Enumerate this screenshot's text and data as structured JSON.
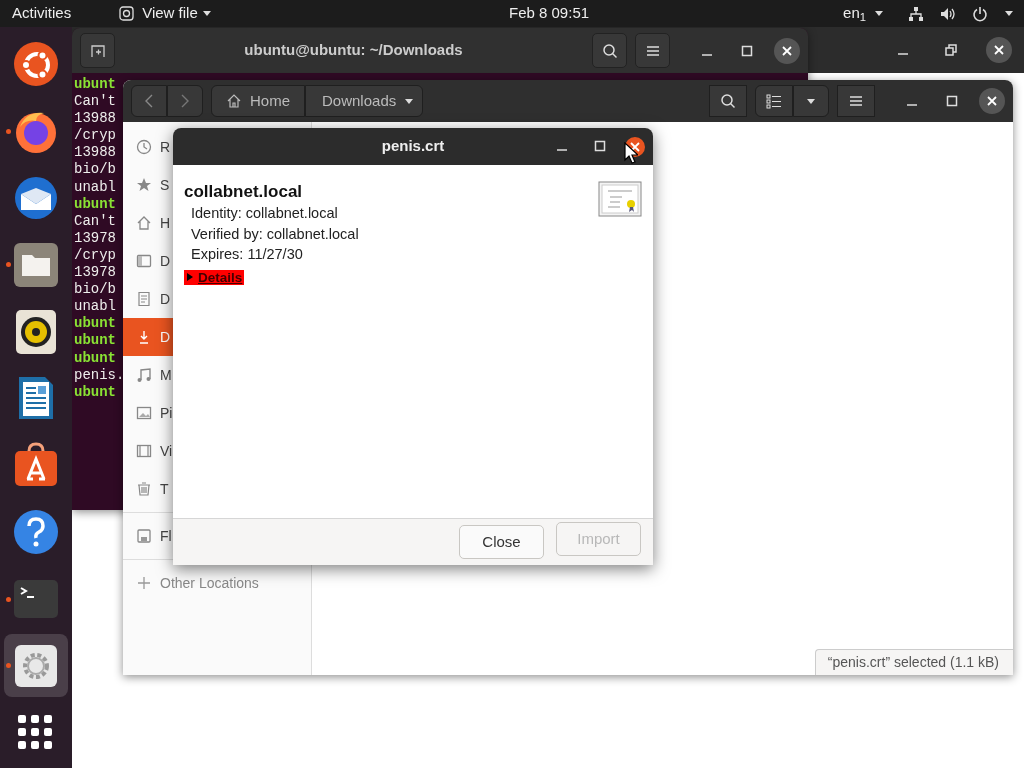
{
  "top_bar": {
    "activities": "Activities",
    "app_menu": "View file",
    "clock": "Feb 8  09:51",
    "input_source": "en$_{1}$"
  },
  "dock": [
    {
      "kind": "ubuntu",
      "running": false,
      "active": false
    },
    {
      "kind": "firefox",
      "running": true,
      "active": false
    },
    {
      "kind": "thunderbird",
      "running": false,
      "active": false
    },
    {
      "kind": "files",
      "running": true,
      "active": false
    },
    {
      "kind": "rhythmbox",
      "running": false,
      "active": false
    },
    {
      "kind": "writer",
      "running": false,
      "active": false
    },
    {
      "kind": "software",
      "running": false,
      "active": false
    },
    {
      "kind": "help",
      "running": false,
      "active": false
    },
    {
      "kind": "terminal",
      "running": true,
      "active": false
    },
    {
      "kind": "settings",
      "running": true,
      "active": true
    },
    {
      "kind": "apps",
      "running": false,
      "active": false
    }
  ],
  "terminal": {
    "title": "ubuntu@ubuntu: ~/Downloads",
    "lines": [
      {
        "text": "ubunt",
        "kind": "prompt"
      },
      {
        "text": "Can't",
        "kind": "output"
      },
      {
        "text": "13988",
        "kind": "output"
      },
      {
        "text": "/cryp",
        "kind": "output"
      },
      {
        "text": "13988",
        "kind": "output"
      },
      {
        "text": "bio/b",
        "kind": "output"
      },
      {
        "text": "unabl",
        "kind": "output"
      },
      {
        "text": "ubunt",
        "kind": "prompt"
      },
      {
        "text": "Can't",
        "kind": "output"
      },
      {
        "text": "13978",
        "kind": "output"
      },
      {
        "text": "/cryp",
        "kind": "output"
      },
      {
        "text": "13978",
        "kind": "output"
      },
      {
        "text": "bio/b",
        "kind": "output"
      },
      {
        "text": "unabl",
        "kind": "output"
      },
      {
        "text": "ubunt",
        "kind": "prompt"
      },
      {
        "text": "ubunt",
        "kind": "prompt"
      },
      {
        "text": "ubunt",
        "kind": "prompt"
      },
      {
        "text": "penis.",
        "kind": "output"
      },
      {
        "text": "ubunt",
        "kind": "prompt"
      }
    ]
  },
  "files": {
    "path": [
      {
        "label": "Home",
        "kind": "home"
      },
      {
        "label": "Downloads",
        "kind": "current"
      }
    ],
    "sidebar": [
      [
        {
          "label": "R",
          "selected": false
        },
        {
          "label": "S",
          "selected": false
        },
        {
          "label": "H",
          "selected": false
        },
        {
          "label": "D",
          "selected": false
        },
        {
          "label": "D",
          "selected": false
        },
        {
          "label": "D",
          "selected": true
        },
        {
          "label": "M",
          "selected": false
        },
        {
          "label": "Pi",
          "selected": false
        },
        {
          "label": "Vi",
          "selected": false
        },
        {
          "label": "T",
          "selected": false
        }
      ],
      [
        {
          "label": "Fl",
          "selected": false
        }
      ],
      [
        {
          "label": "Other Locations",
          "selected": false
        }
      ]
    ],
    "status": "“penis.crt” selected  (1.1 kB)"
  },
  "dialog": {
    "title": "penis.crt",
    "name": "collabnet.local",
    "fields": [
      "Identity: collabnet.local",
      "Verified by: collabnet.local",
      "Expires: 11/27/30"
    ],
    "details": {
      "label": "Details",
      "expanded": false,
      "highlighted": true
    },
    "buttons": [
      {
        "label": "Close",
        "disabled": false
      },
      {
        "label": "Import",
        "disabled": true
      }
    ]
  }
}
